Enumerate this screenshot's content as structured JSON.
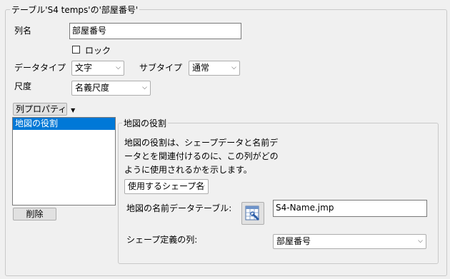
{
  "outer_group": {
    "legend": "テーブル'S4 temps'の'部屋番号'"
  },
  "column_name": {
    "label": "列名",
    "value": "部屋番号"
  },
  "lock": {
    "label": "ロック",
    "checked": false
  },
  "data_type": {
    "label": "データタイプ",
    "value": "文字"
  },
  "subtype": {
    "label": "サブタイプ",
    "value": "通常"
  },
  "scale": {
    "label": "尺度",
    "value": "名義尺度"
  },
  "column_properties": {
    "button_label": "列プロパティ",
    "items": [
      "地図の役割"
    ],
    "selected": "地図の役割"
  },
  "delete_button": {
    "label": "削除"
  },
  "map_role": {
    "legend": "地図の役割",
    "description_line1": "地図の役割は、シェープデータと名前デ",
    "description_line2": "ータとを関連付けるのに、この列がどの",
    "description_line3": "ように使用されるかを示します。",
    "usage_select": "使用するシェープ名",
    "table_label": "地図の名前データテーブル:",
    "table_value": "S4-Name.jmp",
    "shape_col_label": "シェープ定義の列:",
    "shape_col_value": "部屋番号"
  },
  "colors": {
    "selection": "#0078d7",
    "background": "#f0f0f0"
  }
}
